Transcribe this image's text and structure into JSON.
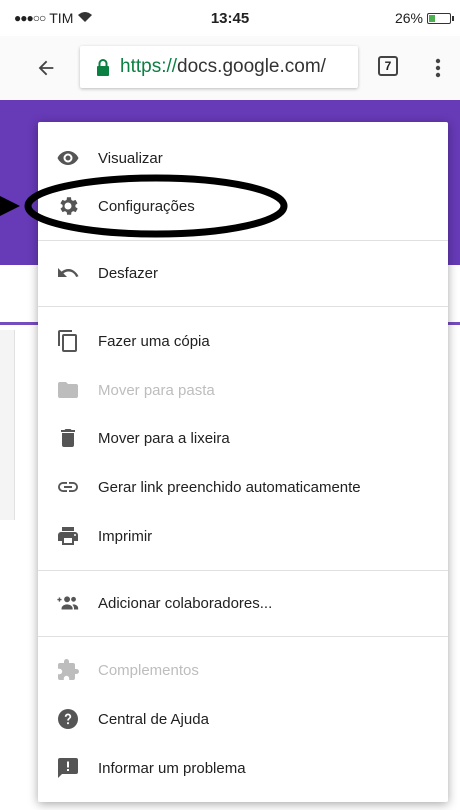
{
  "status_bar": {
    "carrier": "TIM",
    "time": "13:45",
    "battery": "26%"
  },
  "browser": {
    "url_scheme": "https://",
    "url_host": "docs.google.com/",
    "tab_count": "7"
  },
  "menu": {
    "items": [
      {
        "label": "Visualizar",
        "icon": "eye-icon",
        "disabled": false
      },
      {
        "label": "Configurações",
        "icon": "gear-icon",
        "disabled": false
      },
      {
        "label": "Desfazer",
        "icon": "undo-icon",
        "disabled": false
      },
      {
        "label": "Fazer uma cópia",
        "icon": "copy-icon",
        "disabled": false
      },
      {
        "label": "Mover para pasta",
        "icon": "folder-icon",
        "disabled": true
      },
      {
        "label": "Mover para a lixeira",
        "icon": "trash-icon",
        "disabled": false
      },
      {
        "label": "Gerar link preenchido automaticamente",
        "icon": "link-icon",
        "disabled": false
      },
      {
        "label": "Imprimir",
        "icon": "print-icon",
        "disabled": false
      },
      {
        "label": "Adicionar colaboradores...",
        "icon": "add-people-icon",
        "disabled": false
      },
      {
        "label": "Complementos",
        "icon": "puzzle-icon",
        "disabled": true
      },
      {
        "label": "Central de Ajuda",
        "icon": "help-icon",
        "disabled": false
      },
      {
        "label": "Informar um problema",
        "icon": "feedback-icon",
        "disabled": false
      }
    ]
  },
  "colors": {
    "header": "#673ab7",
    "url_scheme": "#0b8043",
    "disabled_text": "#bdbdbd"
  }
}
